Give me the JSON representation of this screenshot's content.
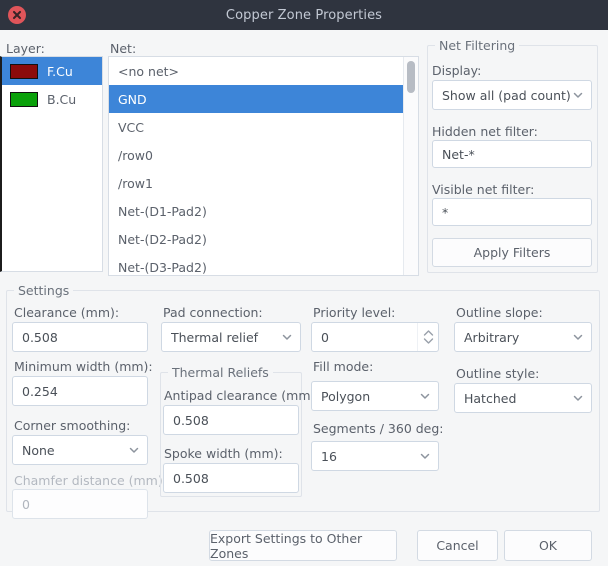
{
  "window": {
    "title": "Copper Zone Properties",
    "close_icon": "close-icon"
  },
  "layer": {
    "label": "Layer:",
    "items": [
      {
        "name": "F.Cu",
        "color": "#8b0b0b",
        "selected": true
      },
      {
        "name": "B.Cu",
        "color": "#0aa10a",
        "selected": false
      }
    ]
  },
  "net": {
    "label": "Net:",
    "items": [
      {
        "name": "<no net>",
        "selected": false
      },
      {
        "name": "GND",
        "selected": true
      },
      {
        "name": "VCC",
        "selected": false
      },
      {
        "name": "/row0",
        "selected": false
      },
      {
        "name": "/row1",
        "selected": false
      },
      {
        "name": "Net-(D1-Pad2)",
        "selected": false
      },
      {
        "name": "Net-(D2-Pad2)",
        "selected": false
      },
      {
        "name": "Net-(D3-Pad2)",
        "selected": false
      }
    ]
  },
  "net_filtering": {
    "title": "Net Filtering",
    "display_label": "Display:",
    "display_value": "Show all (pad count)",
    "hidden_filter_label": "Hidden net filter:",
    "hidden_filter_value": "Net-*",
    "visible_filter_label": "Visible net filter:",
    "visible_filter_value": "*",
    "apply_button": "Apply Filters"
  },
  "settings": {
    "title": "Settings",
    "clearance_label": "Clearance (mm):",
    "clearance_value": "0.508",
    "min_width_label": "Minimum width (mm):",
    "min_width_value": "0.254",
    "corner_smoothing_label": "Corner smoothing:",
    "corner_smoothing_value": "None",
    "chamfer_label": "Chamfer distance (mm):",
    "chamfer_value": "0",
    "pad_connection_label": "Pad connection:",
    "pad_connection_value": "Thermal relief",
    "thermal_reliefs_title": "Thermal Reliefs",
    "antipad_label": "Antipad clearance (mm):",
    "antipad_value": "0.508",
    "spoke_label": "Spoke width (mm):",
    "spoke_value": "0.508",
    "priority_label": "Priority level:",
    "priority_value": "0",
    "fill_mode_label": "Fill mode:",
    "fill_mode_value": "Polygon",
    "segments_label": "Segments / 360 deg:",
    "segments_value": "16",
    "outline_slope_label": "Outline slope:",
    "outline_slope_value": "Arbitrary",
    "outline_style_label": "Outline style:",
    "outline_style_value": "Hatched"
  },
  "footer": {
    "export_button": "Export Settings to Other Zones",
    "cancel_button": "Cancel",
    "ok_button": "OK"
  }
}
